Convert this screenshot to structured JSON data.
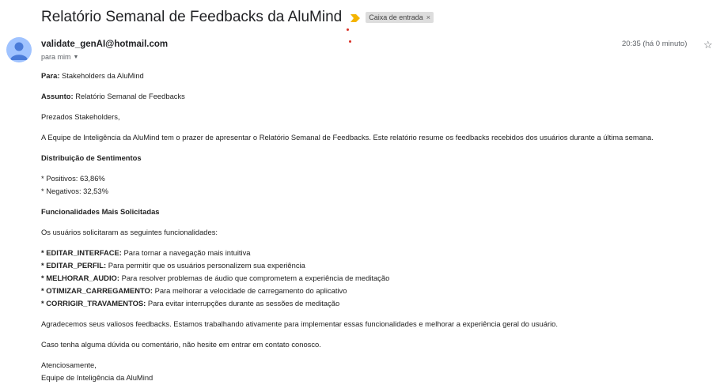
{
  "email": {
    "subject": "Relatório Semanal de Feedbacks da AluMind",
    "label": "Caixa de entrada",
    "label_close": "×",
    "sender": "validate_genAI@hotmail.com",
    "recipient": "para mim",
    "timestamp": "20:35 (há 0 minuto)",
    "icons": {
      "importance": "importance-marker-icon",
      "star": "star-icon",
      "avatar": "avatar-person-icon",
      "caret": "chevron-down-icon"
    },
    "colors": {
      "importance": "#f4b400",
      "avatar_bg": "#a0c3ff",
      "avatar_fg": "#4a7bd9",
      "dot": "#d93025"
    }
  },
  "body": {
    "to_label": "Para:",
    "to_value": " Stakeholders da AluMind",
    "subject_label": "Assunto:",
    "subject_value": " Relatório Semanal de Feedbacks",
    "greeting": "Prezados Stakeholders,",
    "intro": "A Equipe de Inteligência da AluMind tem o prazer de apresentar o Relatório Semanal de Feedbacks. Este relatório resume os feedbacks recebidos dos usuários durante a última semana.",
    "sentiment_heading": "Distribuição de Sentimentos",
    "positive": "* Positivos: 63,86%",
    "negative": "* Negativos: 32,53%",
    "features_heading": "Funcionalidades Mais Solicitadas",
    "features_intro": "Os usuários solicitaram as seguintes funcionalidades:",
    "features": [
      {
        "code": "* EDITAR_INTERFACE:",
        "desc": " Para tornar a navegação mais intuitiva"
      },
      {
        "code": "* EDITAR_PERFIL:",
        "desc": " Para permitir que os usuários personalizem sua experiência"
      },
      {
        "code": "* MELHORAR_AUDIO:",
        "desc": " Para resolver problemas de áudio que comprometem a experiência de meditação"
      },
      {
        "code": "* OTIMIZAR_CARREGAMENTO:",
        "desc": " Para melhorar a velocidade de carregamento do aplicativo"
      },
      {
        "code": "* CORRIGIR_TRAVAMENTOS:",
        "desc": " Para evitar interrupções durante as sessões de meditação"
      }
    ],
    "thanks": "Agradecemos seus valiosos feedbacks. Estamos trabalhando ativamente para implementar essas funcionalidades e melhorar a experiência geral do usuário.",
    "contact": "Caso tenha alguma dúvida ou comentário, não hesite em entrar em contato conosco.",
    "closing": "Atenciosamente,",
    "signature": "Equipe de Inteligência da AluMind"
  }
}
